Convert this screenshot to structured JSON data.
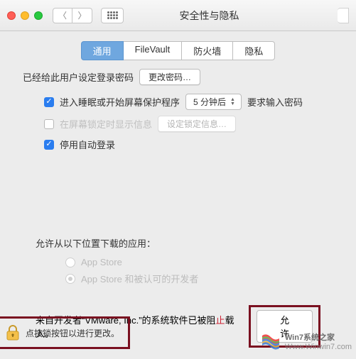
{
  "window": {
    "title": "安全性与隐私"
  },
  "tabs": [
    {
      "label": "通用",
      "active": true
    },
    {
      "label": "FileVault",
      "active": false
    },
    {
      "label": "防火墙",
      "active": false
    },
    {
      "label": "隐私",
      "active": false
    }
  ],
  "password": {
    "set_label": "已经给此用户设定登录密码",
    "change_button": "更改密码…",
    "require_checked": true,
    "require_label_before": "进入睡眠或开始屏幕保护程序",
    "require_select": "5 分钟后",
    "require_label_after": "要求输入密码",
    "lockmsg_checked": false,
    "lockmsg_label": "在屏幕锁定时显示信息",
    "lockmsg_button": "设定锁定信息…",
    "autologin_checked": true,
    "autologin_label": "停用自动登录"
  },
  "download": {
    "section_label": "允许从以下位置下载的应用：",
    "options": [
      {
        "label": "App Store",
        "selected": false
      },
      {
        "label": "App Store 和被认可的开发者",
        "selected": true
      }
    ]
  },
  "blocked": {
    "prefix": "来自开发者“",
    "developer": "VMware, Inc.",
    "mid": "”的系统软件已被阻",
    "stop": "止",
    "suffix": "载入。",
    "allow_button": "允许"
  },
  "lock": {
    "text": "点按锁按钮以进行更改。"
  },
  "watermark": {
    "line1": "Win7系统之家",
    "line2": "Www.Winwin7.com"
  }
}
